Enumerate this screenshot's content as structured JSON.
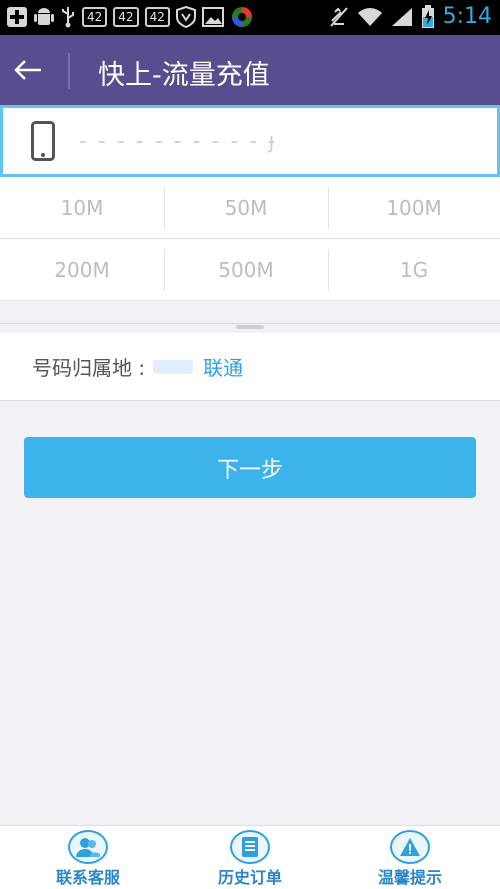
{
  "statusbar": {
    "notif_boxes": [
      "42",
      "42",
      "42"
    ],
    "time": "5:14"
  },
  "appbar": {
    "title": "快上-流量充值"
  },
  "phone": {
    "value": "- - - - - - - - - - ɟ",
    "placeholder": ""
  },
  "packages": [
    [
      "10M",
      "50M",
      "100M"
    ],
    [
      "200M",
      "500M",
      "1G"
    ]
  ],
  "location": {
    "label": "号码归属地 :",
    "carrier": "联通"
  },
  "next_button": "下一步",
  "bottom_nav": [
    {
      "label": "联系客服",
      "icon": "customer-service-icon"
    },
    {
      "label": "历史订单",
      "icon": "order-history-icon"
    },
    {
      "label": "温馨提示",
      "icon": "tips-icon"
    }
  ],
  "colors": {
    "appbar": "#574d8f",
    "accent": "#3db3ec",
    "nav_text": "#2a86c9"
  }
}
